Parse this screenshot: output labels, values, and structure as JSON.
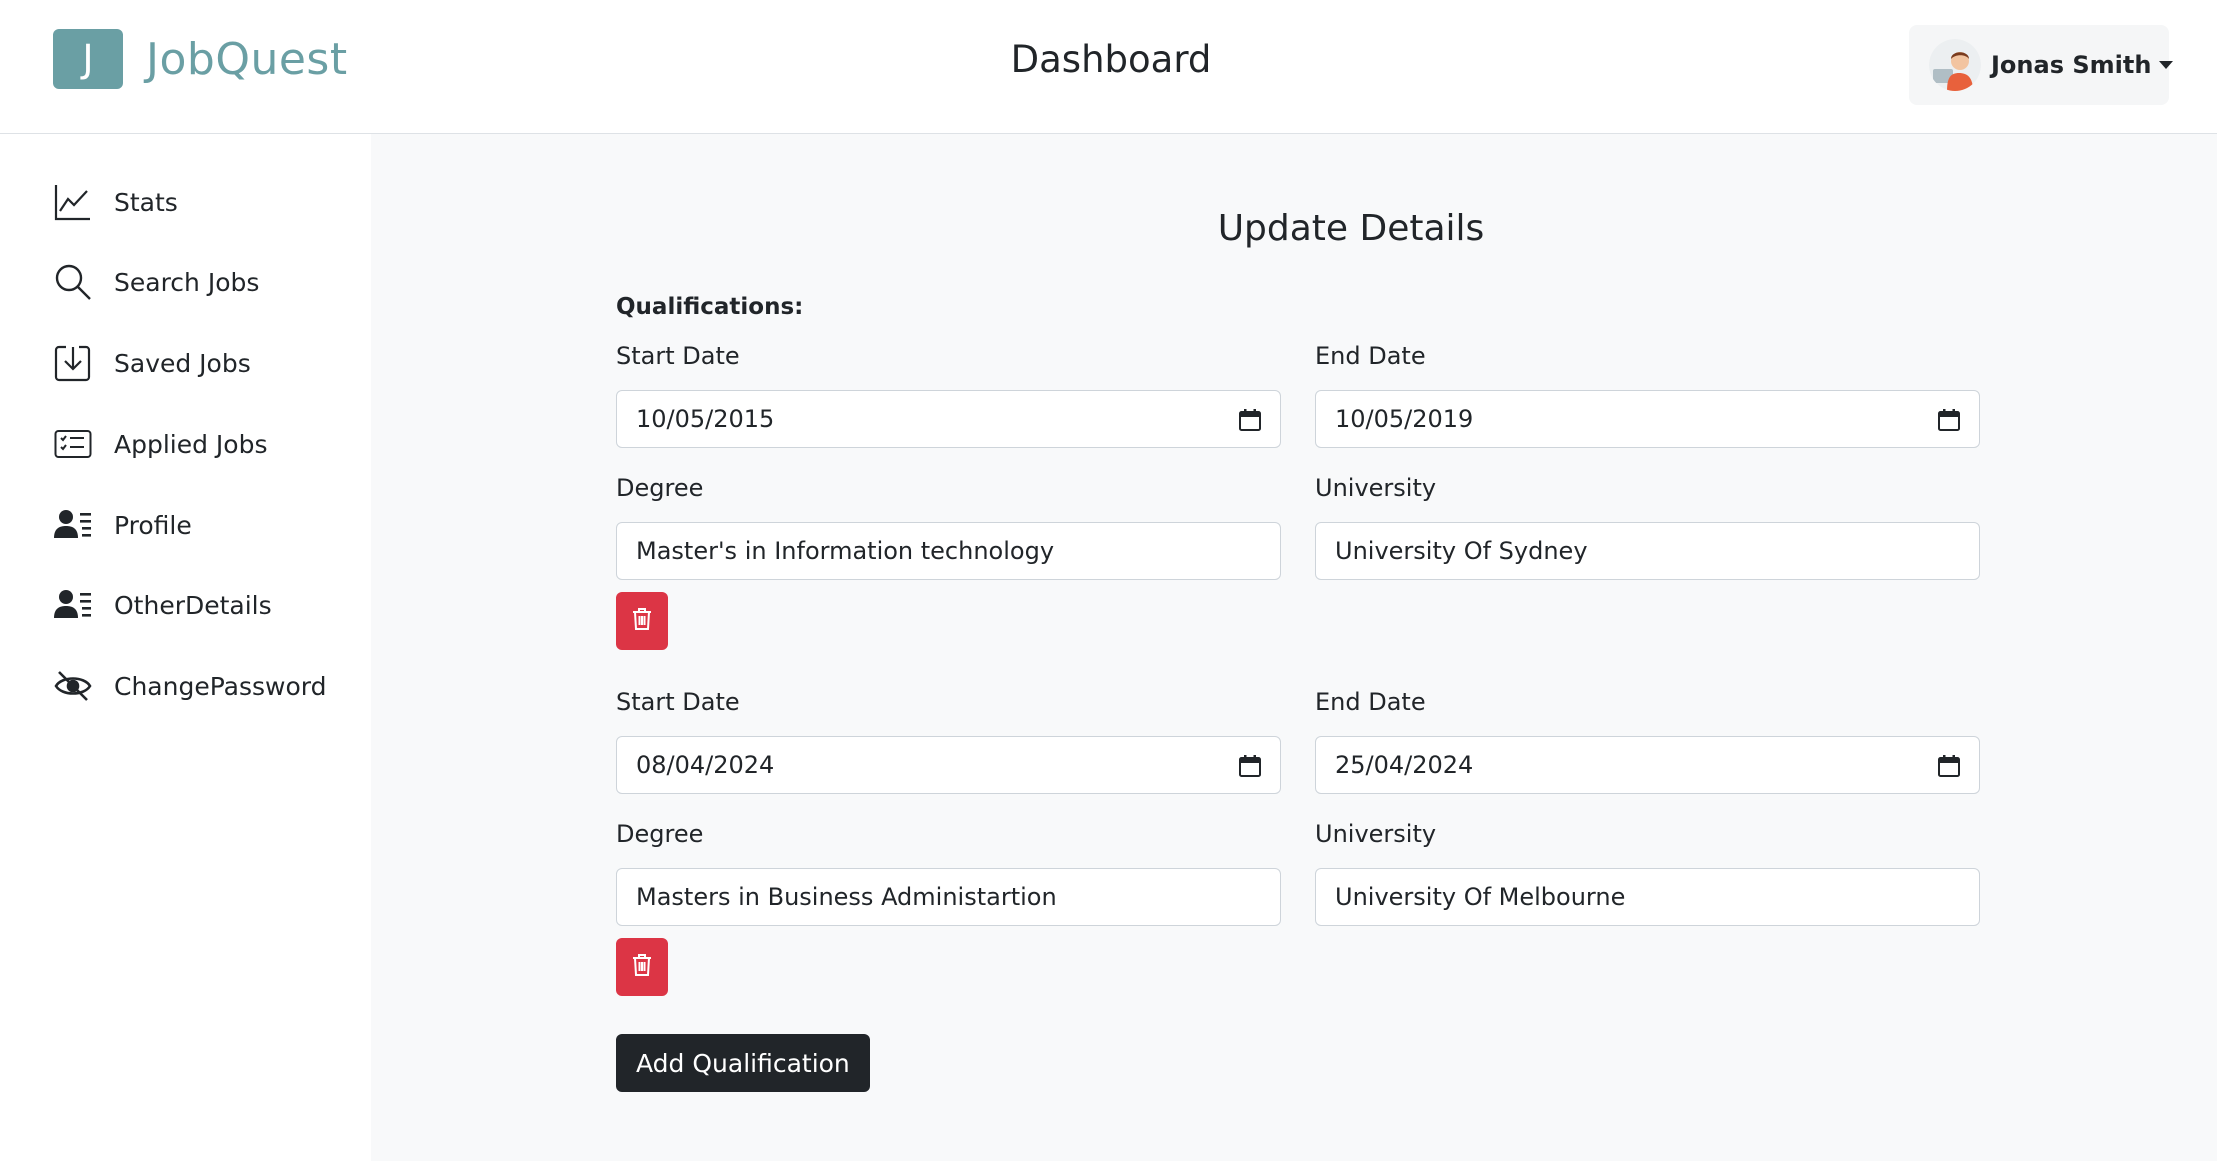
{
  "header": {
    "logo_letter": "J",
    "logo_text": "JobQuest",
    "page_title": "Dashboard",
    "user_name": "Jonas Smith"
  },
  "sidebar": {
    "items": [
      {
        "label": "Stats",
        "icon": "chart-line-icon"
      },
      {
        "label": "Search Jobs",
        "icon": "search-icon"
      },
      {
        "label": "Saved Jobs",
        "icon": "download-box-icon"
      },
      {
        "label": "Applied Jobs",
        "icon": "checklist-card-icon"
      },
      {
        "label": "Profile",
        "icon": "person-lines-icon"
      },
      {
        "label": "OtherDetails",
        "icon": "person-lines-icon"
      },
      {
        "label": "ChangePassword",
        "icon": "eye-slash-icon"
      }
    ]
  },
  "main": {
    "title": "Update Details",
    "qualifications_label": "Qualifications:",
    "qualifications": [
      {
        "start_label": "Start Date",
        "start_value": "10/05/2015",
        "end_label": "End Date",
        "end_value": "10/05/2019",
        "degree_label": "Degree",
        "degree_value": "Master's in Information technology",
        "university_label": "University",
        "university_value": "University Of Sydney"
      },
      {
        "start_label": "Start Date",
        "start_value": "08/04/2024",
        "end_label": "End Date",
        "end_value": "25/04/2024",
        "degree_label": "Degree",
        "degree_value": "Masters in Business Administartion",
        "university_label": "University",
        "university_value": "University Of Melbourne"
      }
    ],
    "add_button_label": "Add Qualification"
  },
  "colors": {
    "brand": "#6a9fa4",
    "danger": "#dc3545",
    "dark_button": "#212529",
    "main_background": "#f8f9fa"
  }
}
